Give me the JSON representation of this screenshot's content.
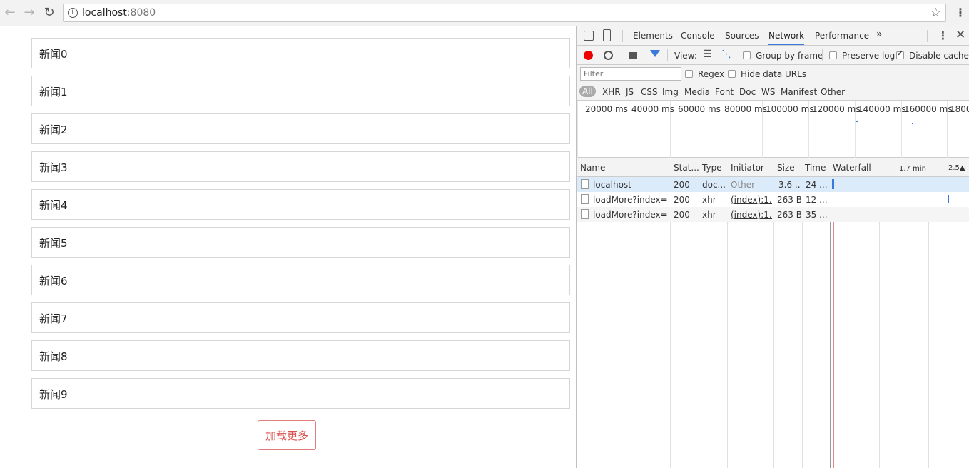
{
  "browser": {
    "url_host": "localhost",
    "url_port": ":8080"
  },
  "page": {
    "news": [
      "新闻0",
      "新闻1",
      "新闻2",
      "新闻3",
      "新闻4",
      "新闻5",
      "新闻6",
      "新闻7",
      "新闻8",
      "新闻9"
    ],
    "load_more_label": "加载更多"
  },
  "devtools": {
    "tabs": [
      "Elements",
      "Console",
      "Sources",
      "Network",
      "Performance"
    ],
    "active_tab": "Network",
    "more_tabs": "»",
    "toolbar": {
      "view_label": "View:",
      "group_by_frame": "Group by frame",
      "preserve_log": "Preserve log",
      "disable_cache": "Disable cache"
    },
    "filter_placeholder": "Filter",
    "regex_label": "Regex",
    "hide_data_urls_label": "Hide data URLs",
    "type_filters": [
      "All",
      "XHR",
      "JS",
      "CSS",
      "Img",
      "Media",
      "Font",
      "Doc",
      "WS",
      "Manifest",
      "Other"
    ],
    "overview_ticks": [
      "20000 ms",
      "40000 ms",
      "60000 ms",
      "80000 ms",
      "100000 ms",
      "120000 ms",
      "140000 ms",
      "160000 ms",
      "1800"
    ],
    "columns": [
      "Name",
      "Stat...",
      "Type",
      "Initiator",
      "Size",
      "Time",
      "Waterfall"
    ],
    "waterfall_ticks": [
      "1.7 min",
      "2.5▲"
    ],
    "requests": [
      {
        "name": "localhost",
        "status": "200",
        "type": "doc...",
        "initiator": "Other",
        "size": "3.6 ...",
        "time": "24 ..."
      },
      {
        "name": "loadMore?index=...",
        "status": "200",
        "type": "xhr",
        "initiator": "(index):1...",
        "size": "263 B",
        "time": "12 ..."
      },
      {
        "name": "loadMore?index=...",
        "status": "200",
        "type": "xhr",
        "initiator": "(index):1...",
        "size": "263 B",
        "time": "35 ..."
      }
    ]
  }
}
